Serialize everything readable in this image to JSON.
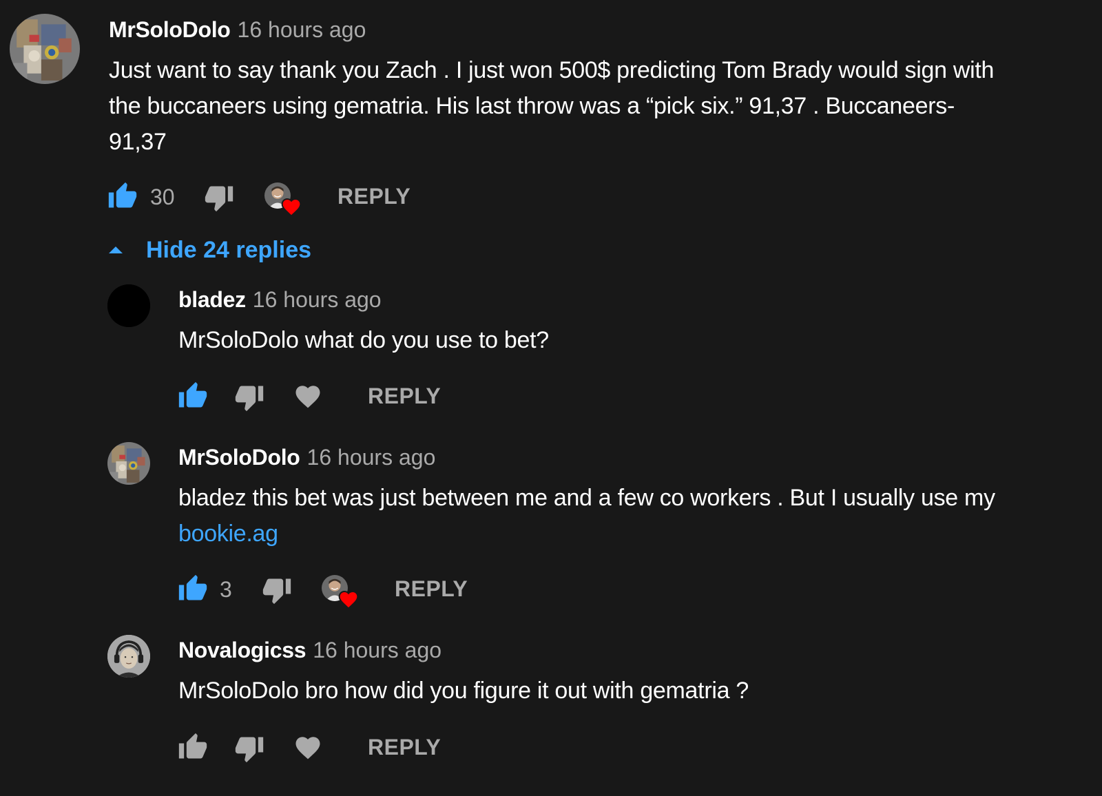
{
  "comment": {
    "author": "MrSoloDolo",
    "time": "16 hours ago",
    "text_line1": "Just want to say thank you Zach . I just won 500$ predicting Tom Brady would sign with",
    "text_line2": "the buccaneers using gematria. His last throw was a “pick six.” 91,37 . Buccaneers-",
    "text_line3": "91,37",
    "likes": "30",
    "reply_label": "REPLY",
    "hearted_by_creator": true,
    "avatar_icon": "abstract-collage-avatar"
  },
  "replies_toggle": {
    "label": "Hide 24 replies",
    "icon": "caret-up-icon"
  },
  "replies": [
    {
      "author": "bladez",
      "time": "16 hours ago",
      "text": "MrSoloDolo what do you use to bet?",
      "likes": "",
      "reply_label": "REPLY",
      "hearted_by_creator": false,
      "avatar_icon": "black-circle-avatar"
    },
    {
      "author": "MrSoloDolo",
      "time": "16 hours ago",
      "text_line1": "bladez this bet was just between me and a few co workers . But I usually use my",
      "link": "bookie.ag",
      "likes": "3",
      "reply_label": "REPLY",
      "hearted_by_creator": true,
      "avatar_icon": "abstract-collage-avatar"
    },
    {
      "author": "Novalogicss",
      "time": "16 hours ago",
      "text": "MrSoloDolo bro how did you figure it out with gematria ?",
      "likes": "",
      "reply_label": "REPLY",
      "hearted_by_creator": false,
      "avatar_icon": "headphones-portrait-avatar"
    }
  ],
  "colors": {
    "background": "#181818",
    "link_blue": "#3ea6ff",
    "like_active_blue": "#3ea6ff",
    "secondary_text": "#aaaaaa",
    "heart_red": "#ff0000"
  }
}
